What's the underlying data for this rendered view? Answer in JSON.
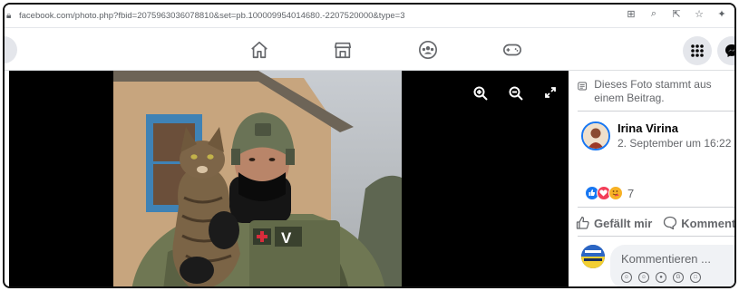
{
  "browser": {
    "url": "facebook.com/photo.php?fbid=2075963036078810&set=pb.100009954014680.-2207520000&type=3",
    "tool_icons": [
      "install-icon",
      "zoom-icon",
      "share-icon",
      "star-icon",
      "extensions-icon"
    ]
  },
  "nav": {
    "icons": [
      "home-icon",
      "marketplace-icon",
      "groups-icon",
      "gaming-icon"
    ],
    "right_icons": [
      "menu-grid-icon",
      "messenger-icon"
    ]
  },
  "viewer": {
    "tools": [
      "zoom-in-icon",
      "zoom-out-icon",
      "fullscreen-icon"
    ],
    "patch_text": "V"
  },
  "panel": {
    "notice": "Dieses Foto stammt aus einem Beitrag.",
    "author_name": "Irina Virina",
    "post_date": "2. September um 16:22 · ☁",
    "reaction_count": "7",
    "like_label": "Gefällt mir",
    "comment_label": "Kommentie",
    "comment_placeholder": "Kommentieren ..."
  },
  "colors": {
    "accent": "#1877f2",
    "secondary_text": "#65676b"
  }
}
